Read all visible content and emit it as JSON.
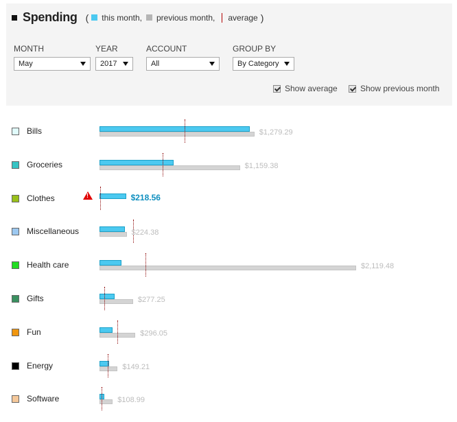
{
  "header": {
    "title": "Spending",
    "legend_open": "(",
    "legend_close": ")",
    "legend_this_month": "this month,",
    "legend_previous_month": "previous month,",
    "legend_average": "average"
  },
  "filters": {
    "month": {
      "label": "MONTH",
      "value": "May"
    },
    "year": {
      "label": "YEAR",
      "value": "2017"
    },
    "account": {
      "label": "ACCOUNT",
      "value": "All"
    },
    "group_by": {
      "label": "GROUP BY",
      "value": "By Category"
    }
  },
  "options": {
    "show_average": {
      "label": "Show average",
      "checked": true
    },
    "show_previous_month": {
      "label": "Show previous month",
      "checked": true
    }
  },
  "colors": {
    "this_month": "#4cc9f0",
    "previous_month": "#d4d4d4",
    "average_line": "#8b0000",
    "over_average_text": "#0e8fbf",
    "warning": "#e00000"
  },
  "scale_max": 2119.48,
  "categories": [
    {
      "name": "Bills",
      "color": "#e0fbfb",
      "this_month": 1240,
      "previous_month": 1279.29,
      "average": 705,
      "amount": "$1,279.29",
      "over": false
    },
    {
      "name": "Groceries",
      "color": "#36c4c4",
      "this_month": 610,
      "previous_month": 1159.38,
      "average": 520,
      "amount": "$1,159.38",
      "over": false
    },
    {
      "name": "Clothes",
      "color": "#99c01a",
      "this_month": 218.56,
      "previous_month": null,
      "average": 4,
      "amount": "$218.56",
      "over": true,
      "warning_icon": "warning-triangle-icon"
    },
    {
      "name": "Miscellaneous",
      "color": "#9cc8f0",
      "this_month": 210,
      "previous_month": 224.38,
      "average": 280,
      "amount": "$224.38",
      "over": false
    },
    {
      "name": "Health care",
      "color": "#22dd22",
      "this_month": 180,
      "previous_month": 2119.48,
      "average": 380,
      "amount": "$2,119.48",
      "over": false
    },
    {
      "name": "Gifts",
      "color": "#3a9060",
      "this_month": 125,
      "previous_month": 277.25,
      "average": 40,
      "amount": "$277.25",
      "over": false
    },
    {
      "name": "Fun",
      "color": "#f0960f",
      "this_month": 105,
      "previous_month": 296.05,
      "average": 150,
      "amount": "$296.05",
      "over": false
    },
    {
      "name": "Energy",
      "color": "#000000",
      "this_month": 82,
      "previous_month": 149.21,
      "average": 70,
      "amount": "$149.21",
      "over": false
    },
    {
      "name": "Software",
      "color": "#f5c89a",
      "this_month": 38,
      "previous_month": 108.99,
      "average": 18,
      "amount": "$108.99",
      "over": false
    }
  ]
}
